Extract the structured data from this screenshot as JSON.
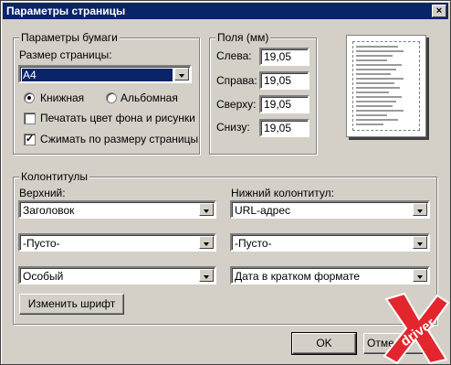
{
  "window": {
    "title": "Параметры страницы",
    "close_glyph": "×"
  },
  "paper": {
    "group_title": "Параметры бумаги",
    "size_label": "Размер страницы:",
    "size_value": "A4",
    "orientation": {
      "portrait": "Книжная",
      "landscape": "Альбомная",
      "selected": "portrait"
    },
    "print_bg_label": "Печатать цвет фона и рисунки",
    "print_bg_checked": false,
    "shrink_label": "Сжимать по размеру страницы",
    "shrink_checked": true,
    "check_glyph": "✓"
  },
  "margins": {
    "group_title": "Поля (мм)",
    "left_label": "Слева:",
    "left_value": "19,05",
    "right_label": "Справа:",
    "right_value": "19,05",
    "top_label": "Сверху:",
    "top_value": "19,05",
    "bottom_label": "Снизу:",
    "bottom_value": "19,05"
  },
  "headers": {
    "group_title": "Колонтитулы",
    "header_label": "Верхний:",
    "footer_label": "Нижний колонтитул:",
    "header_values": [
      "Заголовок",
      "-Пусто-",
      "Особый"
    ],
    "footer_values": [
      "URL-адрес",
      "-Пусто-",
      "Дата в кратком формате"
    ],
    "font_button": "Изменить шрифт"
  },
  "buttons": {
    "ok": "OK",
    "cancel": "Отмена"
  },
  "logo": {
    "text": "driver",
    "icon": "ixbt-driver-logo"
  }
}
